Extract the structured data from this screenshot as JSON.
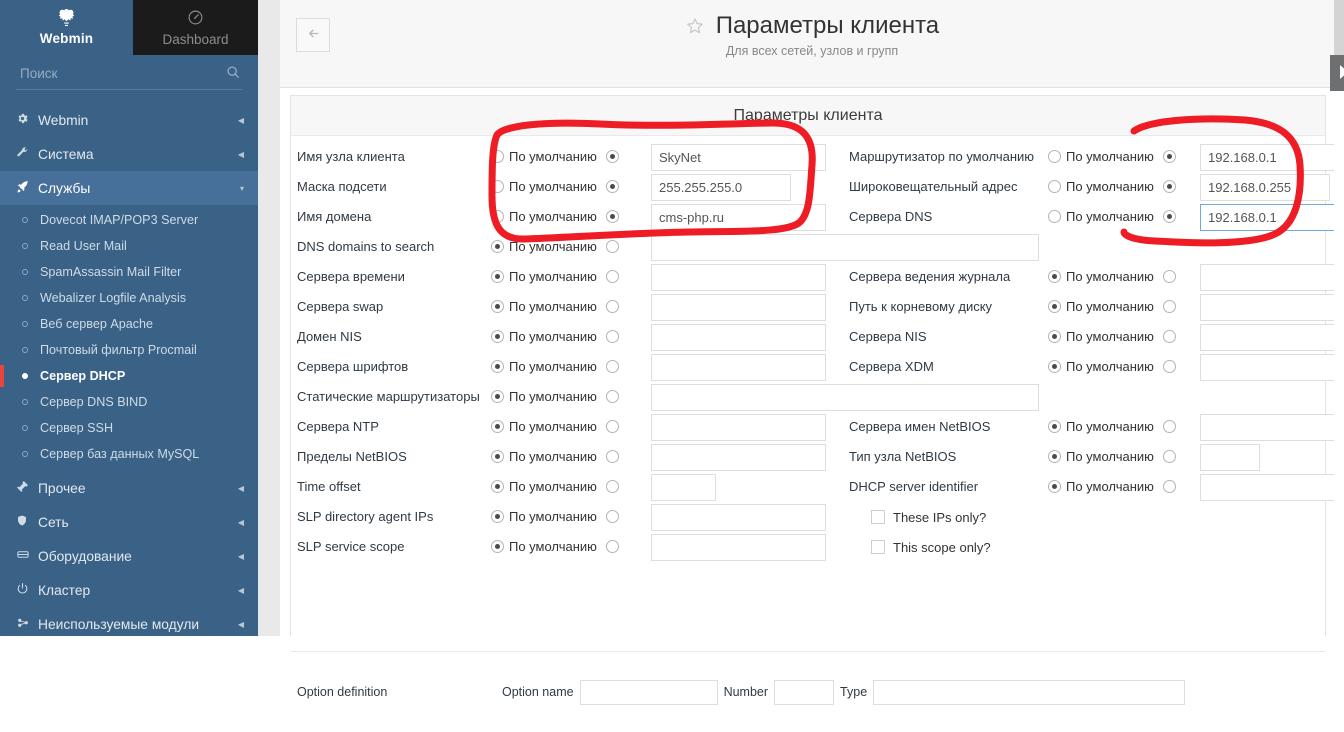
{
  "sidebar": {
    "brand": {
      "label": "Webmin",
      "icon": "webmin-logo-icon"
    },
    "dashboard_tab": {
      "label": "Dashboard",
      "icon": "dashboard-gauge-icon"
    },
    "search": {
      "placeholder": "Поиск",
      "value": "",
      "icon": "search-icon"
    },
    "groups": [
      {
        "label": "Webmin",
        "icon": "gear-icon",
        "caret": "◀",
        "expanded": false
      },
      {
        "label": "Система",
        "icon": "wrench-icon",
        "caret": "◀",
        "expanded": false
      },
      {
        "label": "Службы",
        "icon": "rocket-icon",
        "caret": "▾",
        "expanded": true,
        "items": [
          {
            "label": "Dovecot IMAP/POP3 Server",
            "selected": false
          },
          {
            "label": "Read User Mail",
            "selected": false
          },
          {
            "label": "SpamAssassin Mail Filter",
            "selected": false
          },
          {
            "label": "Webalizer Logfile Analysis",
            "selected": false
          },
          {
            "label": "Веб сервер Apache",
            "selected": false
          },
          {
            "label": "Почтовый фильтр Procmail",
            "selected": false
          },
          {
            "label": "Сервер DHCP",
            "selected": true
          },
          {
            "label": "Сервер DNS BIND",
            "selected": false
          },
          {
            "label": "Сервер SSH",
            "selected": false
          },
          {
            "label": "Сервер баз данных MySQL",
            "selected": false
          }
        ]
      },
      {
        "label": "Прочее",
        "icon": "hammer-icon",
        "caret": "◀",
        "expanded": false
      },
      {
        "label": "Сеть",
        "icon": "shield-icon",
        "caret": "◀",
        "expanded": false
      },
      {
        "label": "Оборудование",
        "icon": "hardware-icon",
        "caret": "◀",
        "expanded": false
      },
      {
        "label": "Кластер",
        "icon": "power-icon",
        "caret": "◀",
        "expanded": false
      },
      {
        "label": "Неиспользуемые модули",
        "icon": "plug-icon",
        "caret": "◀",
        "expanded": false
      }
    ]
  },
  "header": {
    "back_icon": "arrow-left-icon",
    "star_icon": "star-outline-icon",
    "title": "Параметры клиента",
    "subtitle": "Для всех сетей, узлов и групп"
  },
  "panel": {
    "title": "Параметры клиента"
  },
  "form": {
    "default_label": "По умолчанию",
    "left_rows": [
      {
        "label": "Имя узла клиента",
        "default_on": false,
        "custom_on": true,
        "value": "SkyNet",
        "input_width": 175
      },
      {
        "label": "Маска подсети",
        "default_on": false,
        "custom_on": true,
        "value": "255.255.255.0",
        "input_width": 140
      },
      {
        "label": "Имя домена",
        "default_on": false,
        "custom_on": true,
        "value": "cms-php.ru",
        "input_width": 175
      },
      {
        "label": "DNS domains to search",
        "default_on": true,
        "custom_on": false,
        "value": "",
        "input_width": 388,
        "wide": true
      },
      {
        "label": "Сервера времени",
        "default_on": true,
        "custom_on": false,
        "value": "",
        "input_width": 175
      },
      {
        "label": "Сервера swap",
        "default_on": true,
        "custom_on": false,
        "value": "",
        "input_width": 175
      },
      {
        "label": "Домен NIS",
        "default_on": true,
        "custom_on": false,
        "value": "",
        "input_width": 175
      },
      {
        "label": "Сервера шрифтов",
        "default_on": true,
        "custom_on": false,
        "value": "",
        "input_width": 175
      },
      {
        "label": "Статические маршрутизаторы",
        "default_on": true,
        "custom_on": false,
        "value": "",
        "input_width": 388,
        "wide": true
      },
      {
        "label": "Сервера NTP",
        "default_on": true,
        "custom_on": false,
        "value": "",
        "input_width": 175
      },
      {
        "label": "Пределы NetBIOS",
        "default_on": true,
        "custom_on": false,
        "value": "",
        "input_width": 175
      },
      {
        "label": "Time offset",
        "default_on": true,
        "custom_on": false,
        "value": "",
        "input_width": 65
      },
      {
        "label": "SLP directory agent IPs",
        "default_on": true,
        "custom_on": false,
        "value": "",
        "input_width": 175
      },
      {
        "label": "SLP service scope",
        "default_on": true,
        "custom_on": false,
        "value": "",
        "input_width": 175
      }
    ],
    "right_rows": [
      {
        "label": "Маршрутизатор по умолчанию",
        "default_on": false,
        "custom_on": true,
        "value": "192.168.0.1",
        "input_width": 163,
        "focused": false
      },
      {
        "label": "Широковещательный адрес",
        "default_on": false,
        "custom_on": true,
        "value": "192.168.0.255",
        "input_width": 130,
        "focused": false
      },
      {
        "label": "Сервера DNS",
        "default_on": false,
        "custom_on": true,
        "value": "192.168.0.1",
        "input_width": 163,
        "focused": true
      },
      {
        "label": "Сервера ведения журнала",
        "default_on": true,
        "custom_on": false,
        "value": "",
        "input_width": 163
      },
      {
        "label": "Путь к корневому диску",
        "default_on": true,
        "custom_on": false,
        "value": "",
        "input_width": 163
      },
      {
        "label": "Сервера NIS",
        "default_on": true,
        "custom_on": false,
        "value": "",
        "input_width": 163
      },
      {
        "label": "Сервера XDM",
        "default_on": true,
        "custom_on": false,
        "value": "",
        "input_width": 163
      },
      {
        "label": "Сервера имен NetBIOS",
        "default_on": true,
        "custom_on": false,
        "value": "",
        "input_width": 163
      },
      {
        "label": "Тип узла NetBIOS",
        "default_on": true,
        "custom_on": false,
        "value": "",
        "input_width": 60
      },
      {
        "label": "DHCP server identifier",
        "default_on": true,
        "custom_on": false,
        "value": "",
        "input_width": 163
      }
    ],
    "checkboxes": [
      {
        "label": "These IPs only?",
        "checked": false
      },
      {
        "label": "This scope only?",
        "checked": false
      }
    ]
  },
  "option_definition": {
    "label": "Option definition",
    "name_label": "Option name",
    "name_value": "",
    "number_label": "Number",
    "number_value": "",
    "type_label": "Type",
    "type_value": ""
  },
  "annotations": {
    "color": "#ee1c24",
    "shapes": [
      "left-circle-highlight",
      "right-circle-highlight"
    ]
  }
}
